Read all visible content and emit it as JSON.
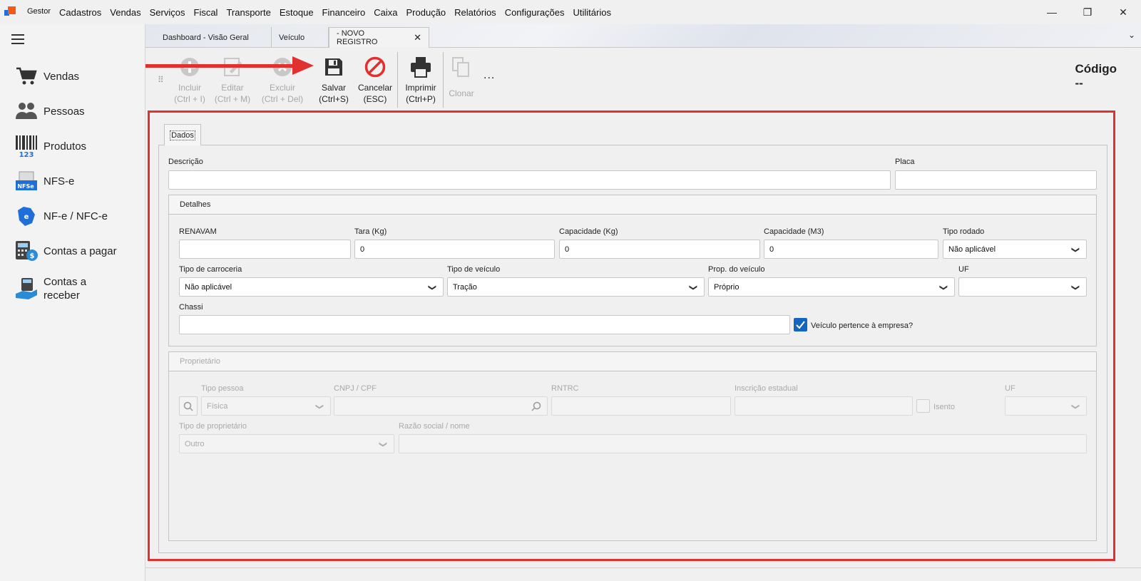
{
  "menu": {
    "app": "Gestor",
    "items": [
      "Cadastros",
      "Vendas",
      "Serviços",
      "Fiscal",
      "Transporte",
      "Estoque",
      "Financeiro",
      "Caixa",
      "Produção",
      "Relatórios",
      "Configurações",
      "Utilitários"
    ]
  },
  "window": {
    "minimize": "—",
    "restore": "❐",
    "close": "✕"
  },
  "sidebar": {
    "items": [
      {
        "label": "Vendas",
        "icon": "cart-icon"
      },
      {
        "label": "Pessoas",
        "icon": "people-icon"
      },
      {
        "label": "Produtos",
        "icon": "barcode-icon"
      },
      {
        "label": "NFS-e",
        "icon": "nfse-icon"
      },
      {
        "label": "NF-e / NFC-e",
        "icon": "nfe-icon"
      },
      {
        "label": "Contas a pagar",
        "icon": "calculator-money-icon"
      },
      {
        "label": "Contas a receber",
        "icon": "hand-money-icon"
      }
    ]
  },
  "tabs": [
    {
      "label": "Dashboard - Visão Geral"
    },
    {
      "label": "Veículo"
    },
    {
      "label": "- NOVO REGISTRO",
      "close": "✕"
    }
  ],
  "toolbar": {
    "incluir": "Incluir\n(Ctrl + I)",
    "editar": "Editar\n(Ctrl + M)",
    "excluir": "Excluir\n(Ctrl + Del)",
    "salvar": "Salvar\n(Ctrl+S)",
    "cancelar": "Cancelar\n(ESC)",
    "imprimir": "Imprimir\n(Ctrl+P)",
    "clonar": "Clonar",
    "more": "...",
    "codigo_label": "Código",
    "codigo_value": "--"
  },
  "form": {
    "tab": "Dados",
    "descricao_label": "Descrição",
    "descricao_value": "",
    "placa_label": "Placa",
    "placa_value": "",
    "detalhes": {
      "title": "Detalhes",
      "renavam_label": "RENAVAM",
      "renavam_value": "",
      "tara_label": "Tara (Kg)",
      "tara_value": "0",
      "cap_kg_label": "Capacidade (Kg)",
      "cap_kg_value": "0",
      "cap_m3_label": "Capacidade (M3)",
      "cap_m3_value": "0",
      "tipo_rodado_label": "Tipo rodado",
      "tipo_rodado_value": "Não aplicável",
      "tipo_carroceria_label": "Tipo de carroceria",
      "tipo_carroceria_value": "Não aplicável",
      "tipo_veiculo_label": "Tipo de veículo",
      "tipo_veiculo_value": "Tração",
      "prop_veiculo_label": "Prop. do veículo",
      "prop_veiculo_value": "Próprio",
      "uf_label": "UF",
      "uf_value": "",
      "chassi_label": "Chassi",
      "chassi_value": "",
      "pertence_label": "Veículo pertence à empresa?",
      "pertence_checked": true
    },
    "proprietario": {
      "title": "Proprietário",
      "tipo_pessoa_label": "Tipo pessoa",
      "tipo_pessoa_value": "Física",
      "cnpj_label": "CNPJ / CPF",
      "cnpj_value": "",
      "rntrc_label": "RNTRC",
      "rntrc_value": "",
      "ie_label": "Inscrição estadual",
      "ie_value": "",
      "isento_label": "Isento",
      "uf_label": "UF",
      "uf_value": "",
      "tipo_prop_label": "Tipo de proprietário",
      "tipo_prop_value": "Outro",
      "razao_label": "Razão social / nome",
      "razao_value": ""
    }
  },
  "colors": {
    "accent_red": "#e03030",
    "check_blue": "#1565c0"
  }
}
